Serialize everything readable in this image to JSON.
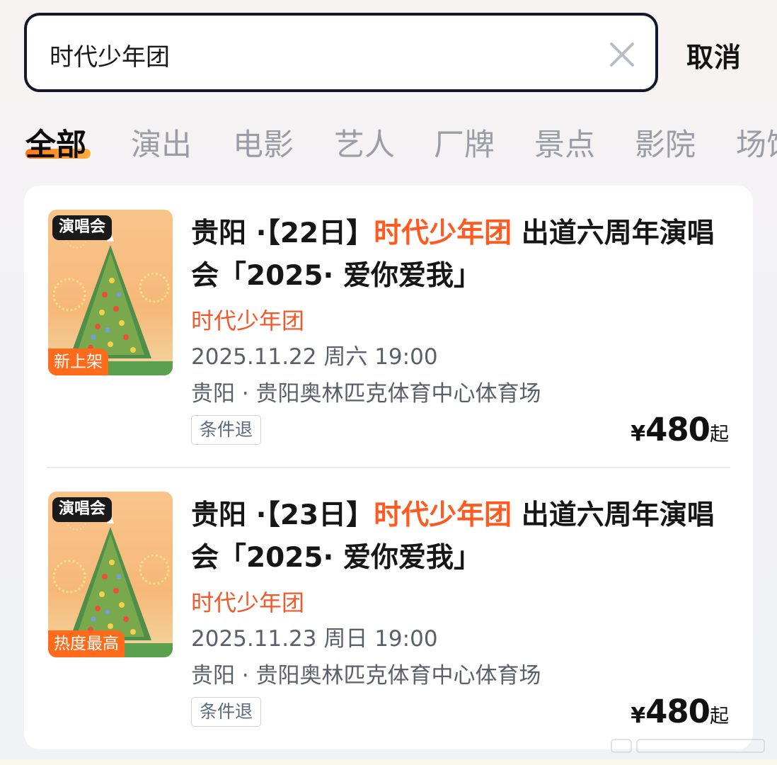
{
  "search": {
    "value": "时代少年团",
    "cancel_label": "取消"
  },
  "tabs": [
    {
      "label": "全部",
      "active": true
    },
    {
      "label": "演出"
    },
    {
      "label": "电影"
    },
    {
      "label": "艺人"
    },
    {
      "label": "厂牌"
    },
    {
      "label": "景点"
    },
    {
      "label": "影院"
    },
    {
      "label": "场馆"
    }
  ],
  "results": [
    {
      "poster_tag": "演唱会",
      "poster_badge": "新上架",
      "title_prefix": "贵阳 ·【22日】",
      "title_highlight": "时代少年团",
      "title_suffix": " 出道六周年演唱会「2025· 爱你爱我」",
      "artist": "时代少年团",
      "datetime": "2025.11.22 周六 19:00",
      "venue": "贵阳 · 贵阳奥林匹克体育中心体育场",
      "refund_tag": "条件退",
      "price_currency": "¥",
      "price_value": "480",
      "price_suffix": "起"
    },
    {
      "poster_tag": "演唱会",
      "poster_badge": "热度最高",
      "title_prefix": "贵阳 ·【23日】",
      "title_highlight": "时代少年团",
      "title_suffix": " 出道六周年演唱会「2025· 爱你爱我」",
      "artist": "时代少年团",
      "datetime": "2025.11.23 周日 19:00",
      "venue": "贵阳 · 贵阳奥林匹克体育中心体育场",
      "refund_tag": "条件退",
      "price_currency": "¥",
      "price_value": "480",
      "price_suffix": "起"
    }
  ],
  "colors": {
    "accent": "#ff5a1f",
    "tab_underline": "#ff8a20",
    "muted_text": "#5b5f6b"
  },
  "icons": {
    "clear": "close-icon"
  }
}
